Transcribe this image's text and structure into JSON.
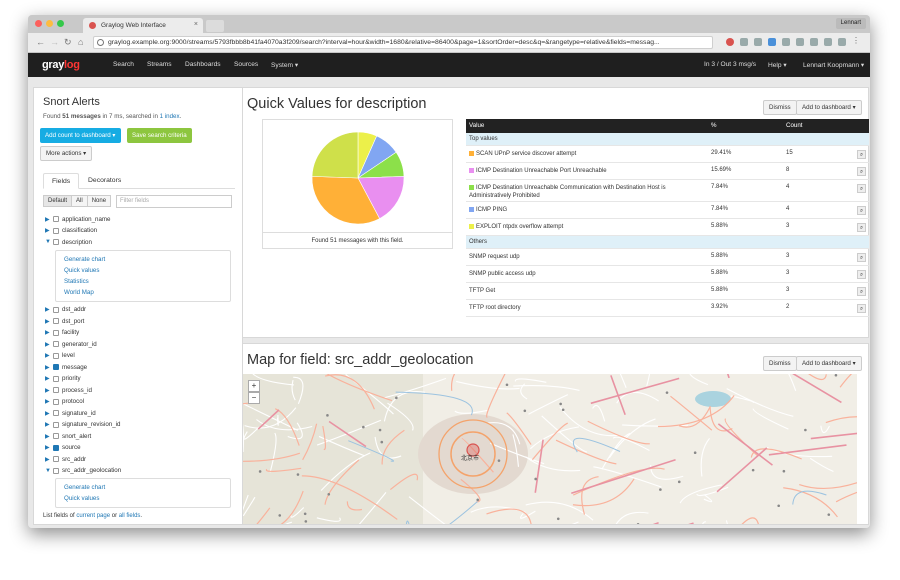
{
  "browser": {
    "tab_title": "Graylog Web Interface",
    "url": "graylog.example.org:9000/streams/5793fbbb8b41fa4070a3f209/search?interval=hour&width=1680&relative=86400&page=1&sortOrder=desc&q=&rangetype=relative&fields=messag...",
    "profile": "Lennart"
  },
  "navbar": {
    "logo_main": "gray",
    "logo_accent": "log",
    "items": [
      "Search",
      "Streams",
      "Dashboards",
      "Sources",
      "System ▾"
    ],
    "throughput": "In 3 / Out 3 msg/s",
    "help": "Help ▾",
    "user": "Lennart Koopmann ▾"
  },
  "sidebar": {
    "title": "Snort Alerts",
    "summary_prefix": "Found ",
    "summary_count": "51 messages",
    "summary_mid": " in 7 ms, searched in ",
    "summary_link": "1 index",
    "summary_suffix": ".",
    "add_count_button": "Add count to dashboard ▾",
    "save_search_button": "Save search criteria",
    "more_actions_button": "More actions ▾",
    "tabs": [
      "Fields",
      "Decorators"
    ],
    "filter_buttons": [
      "Default",
      "All",
      "None"
    ],
    "filter_placeholder": "Filter fields",
    "fields": [
      {
        "name": "application_name",
        "checked": false,
        "expanded": false
      },
      {
        "name": "classification",
        "checked": false,
        "expanded": false
      },
      {
        "name": "description",
        "checked": false,
        "expanded": true
      },
      {
        "name": "dst_addr",
        "checked": false,
        "expanded": false
      },
      {
        "name": "dst_port",
        "checked": false,
        "expanded": false
      },
      {
        "name": "facility",
        "checked": false,
        "expanded": false
      },
      {
        "name": "generator_id",
        "checked": false,
        "expanded": false
      },
      {
        "name": "level",
        "checked": false,
        "expanded": false
      },
      {
        "name": "message",
        "checked": true,
        "expanded": false
      },
      {
        "name": "priority",
        "checked": false,
        "expanded": false
      },
      {
        "name": "process_id",
        "checked": false,
        "expanded": false
      },
      {
        "name": "protocol",
        "checked": false,
        "expanded": false
      },
      {
        "name": "signature_id",
        "checked": false,
        "expanded": false
      },
      {
        "name": "signature_revision_id",
        "checked": false,
        "expanded": false
      },
      {
        "name": "snort_alert",
        "checked": false,
        "expanded": false
      },
      {
        "name": "source",
        "checked": true,
        "expanded": false
      },
      {
        "name": "src_addr",
        "checked": false,
        "expanded": false
      },
      {
        "name": "src_addr_geolocation",
        "checked": false,
        "expanded": true
      }
    ],
    "description_actions": [
      "Generate chart",
      "Quick values",
      "Statistics",
      "World Map"
    ],
    "geolocation_actions": [
      "Generate chart",
      "Quick values"
    ],
    "list_prefix": "List fields of ",
    "list_link1": "current page",
    "list_mid": " or ",
    "list_link2": "all fields",
    "list_suffix": "."
  },
  "quick_values": {
    "title": "Quick Values for description",
    "dismiss": "Dismiss",
    "add_to_dashboard": "Add to dashboard ▾",
    "pie_caption": "Found 51 messages with this field.",
    "columns": [
      "Value",
      "%",
      "Count"
    ],
    "top_label": "Top values",
    "others_label": "Others",
    "top_rows": [
      {
        "value": "SCAN UPnP service discover attempt",
        "percent": "29.41%",
        "count": "15",
        "color": "#ffb037"
      },
      {
        "value": "ICMP Destination Unreachable Port Unreachable",
        "percent": "15.69%",
        "count": "8",
        "color": "#e98ff0"
      },
      {
        "value": "ICMP Destination Unreachable Communication with Destination Host is Administratively Prohibited",
        "percent": "7.84%",
        "count": "4",
        "color": "#8ce04a"
      },
      {
        "value": "ICMP PING",
        "percent": "7.84%",
        "count": "4",
        "color": "#81a6f2"
      },
      {
        "value": "EXPLOIT ntpdx overflow attempt",
        "percent": "5.88%",
        "count": "3",
        "color": "#ecf04a"
      }
    ],
    "other_rows": [
      {
        "value": "SNMP request udp",
        "percent": "5.88%",
        "count": "3"
      },
      {
        "value": "SNMP public access udp",
        "percent": "5.88%",
        "count": "3"
      },
      {
        "value": "TFTP Get",
        "percent": "5.88%",
        "count": "3"
      },
      {
        "value": "TFTP root directory",
        "percent": "3.92%",
        "count": "2"
      }
    ],
    "pie_other_color": "#cfe04a"
  },
  "map": {
    "title": "Map for field: src_addr_geolocation",
    "dismiss": "Dismiss",
    "add_to_dashboard": "Add to dashboard ▾",
    "zoom_in": "+",
    "zoom_out": "−",
    "center_label": "北京市"
  }
}
